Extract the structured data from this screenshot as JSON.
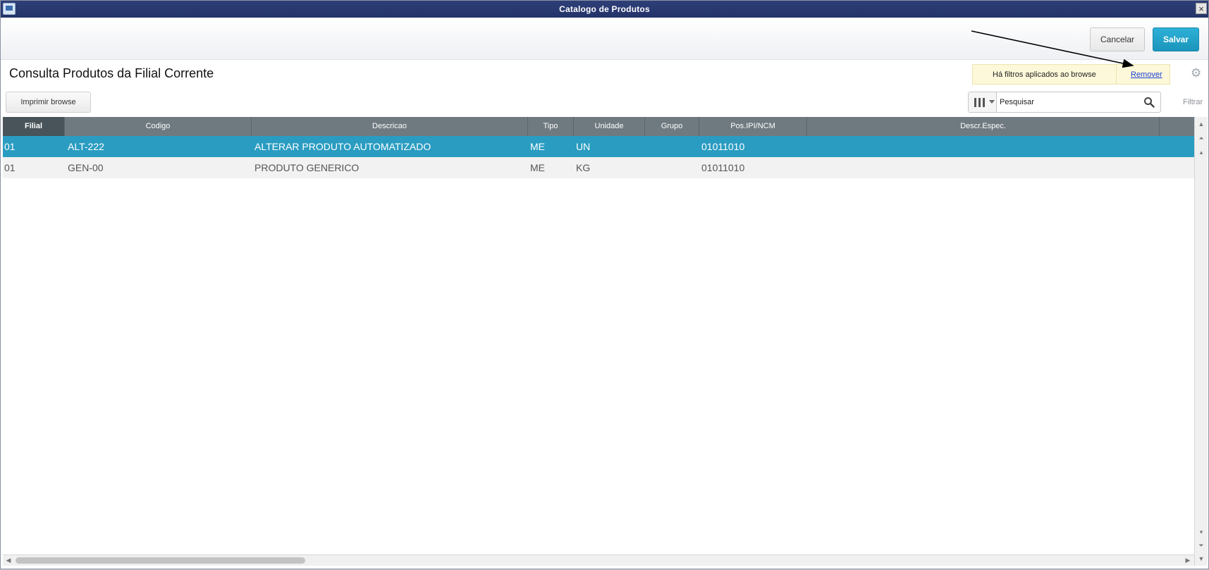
{
  "window": {
    "title": "Catalogo de Produtos",
    "close_glyph": "×"
  },
  "toolbar": {
    "cancel_label": "Cancelar",
    "save_label": "Salvar"
  },
  "page": {
    "title": "Consulta Produtos da Filial Corrente"
  },
  "filter_banner": {
    "message": "Há filtros aplicados ao browse",
    "remove_label": "Remover"
  },
  "actions": {
    "print_label": "Imprimir browse",
    "filter_label": "Filtrar"
  },
  "search": {
    "placeholder": "Pesquisar"
  },
  "grid": {
    "columns": [
      "Filial",
      "Codigo",
      "Descricao",
      "Tipo",
      "Unidade",
      "Grupo",
      "Pos.IPI/NCM",
      "Descr.Espec."
    ],
    "rows": [
      {
        "filial": "01",
        "codigo": "ALT-222",
        "descricao": "ALTERAR PRODUTO AUTOMATIZADO",
        "tipo": "ME",
        "unidade": "UN",
        "grupo": "",
        "ncm": "01011010",
        "descr_espec": "",
        "selected": true
      },
      {
        "filial": "01",
        "codigo": "GEN-00",
        "descricao": "PRODUTO GENERICO",
        "tipo": "ME",
        "unidade": "KG",
        "grupo": "",
        "ncm": "01011010",
        "descr_espec": "",
        "selected": false
      }
    ]
  },
  "icons": {
    "app": "window-icon",
    "close": "close-icon",
    "gear": "gear-icon",
    "columns": "columns-icon",
    "search": "search-icon"
  },
  "colors": {
    "titlebar": "#2e3f78",
    "accent": "#2a9cc1",
    "save_button": "#1b95bc",
    "header": "#6f7a80",
    "banner": "#fdf8d9"
  }
}
